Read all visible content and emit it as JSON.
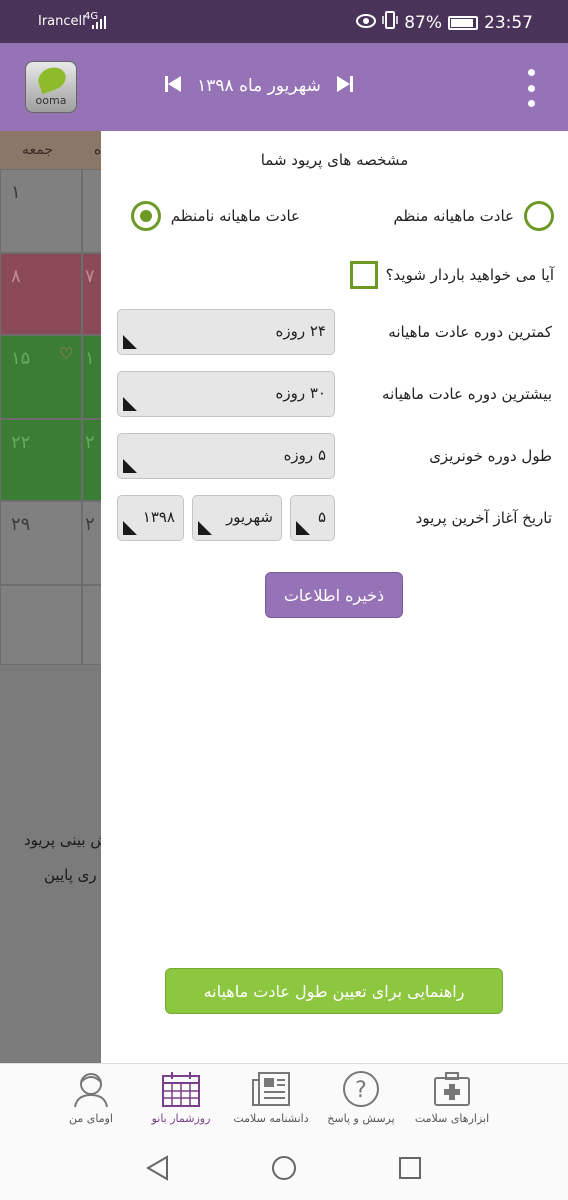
{
  "status_bar": {
    "carrier": "Irancell",
    "network": "4G",
    "battery": "87%",
    "time": "23:57"
  },
  "header": {
    "logo_text": "ooma",
    "month_title": "شهریور ماه ۱۳۹۸"
  },
  "calendar_bg": {
    "day_header_friday": "جمعه",
    "day_header_partial": "ه",
    "col_friday_days": [
      "۱",
      "۸",
      "۱۵",
      "۲۲",
      "۲۹"
    ],
    "col_thursday_partial": [
      "",
      "۷",
      "۱",
      "۲",
      "۲"
    ],
    "text_line1": "ش بینی پریود",
    "text_line2": "ری پایین"
  },
  "panel": {
    "title": "مشخصه های پریود شما",
    "radio_regular": "عادت ماهیانه منظم",
    "radio_irregular": "عادت ماهیانه نامنظم",
    "selected_radio": "irregular",
    "pregnancy_question": "آیا می خواهید باردار شوید؟",
    "pregnancy_checked": false,
    "min_cycle_label": "کمترین دوره عادت ماهیانه",
    "min_cycle_value": "۲۴ روزه",
    "max_cycle_label": "بیشترین دوره عادت ماهیانه",
    "max_cycle_value": "۳۰ روزه",
    "bleeding_label": "طول دوره خونریزی",
    "bleeding_value": "۵ روزه",
    "last_period_label": "تاریخ آغاز آخرین پریود",
    "last_period_day": "۵",
    "last_period_month": "شهریور",
    "last_period_year": "۱۳۹۸",
    "save_button": "ذخیره اطلاعات",
    "guide_button": "راهنمایی برای تعیین طول عادت ماهیانه"
  },
  "bottom_nav": {
    "items": [
      {
        "label": "ابزارهای سلامت",
        "icon": "medkit-icon"
      },
      {
        "label": "پرسش و پاسخ",
        "icon": "question-icon"
      },
      {
        "label": "دانشنامه سلامت",
        "icon": "newspaper-icon"
      },
      {
        "label": "روزشمار بانو",
        "icon": "calendar-icon",
        "active": true
      },
      {
        "label": "اومای من",
        "icon": "user-icon"
      }
    ]
  },
  "colors": {
    "header": "#9672b6",
    "accent_green": "#8dc63f",
    "radio_green": "#6c9a25"
  }
}
